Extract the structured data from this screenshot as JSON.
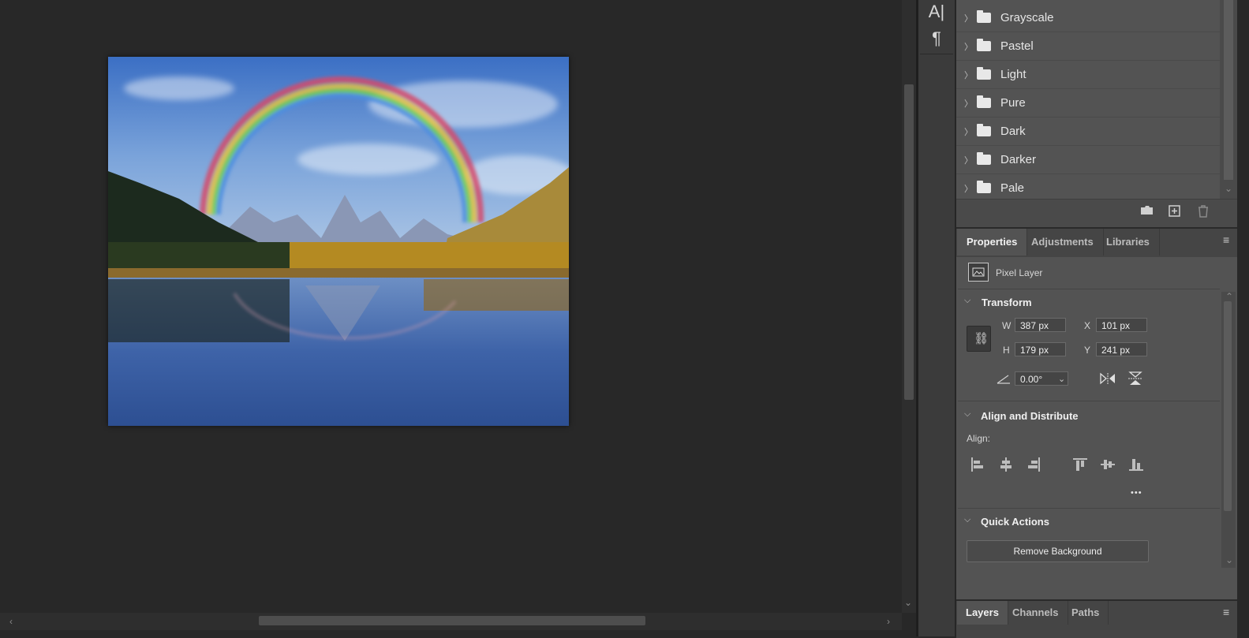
{
  "swatch_groups": [
    "Grayscale",
    "Pastel",
    "Light",
    "Pure",
    "Dark",
    "Darker",
    "Pale"
  ],
  "properties_tabs": [
    "Properties",
    "Adjustments",
    "Libraries"
  ],
  "layer_kind": "Pixel Layer",
  "transform": {
    "title": "Transform",
    "w_label": "W",
    "w_value": "387 px",
    "h_label": "H",
    "h_value": "179 px",
    "x_label": "X",
    "x_value": "101 px",
    "y_label": "Y",
    "y_value": "241 px",
    "angle_value": "0.00°"
  },
  "align": {
    "title": "Align and Distribute",
    "align_label": "Align:",
    "more": "•••"
  },
  "quick_actions": {
    "title": "Quick Actions",
    "remove_background": "Remove Background"
  },
  "bottom_tabs": [
    "Layers",
    "Channels",
    "Paths"
  ],
  "strip_icons": [
    "character-icon",
    "paragraph-icon"
  ],
  "colors": {
    "panel_bg": "#535353",
    "canvas_bg": "#282828",
    "tab_bg": "#454545"
  }
}
